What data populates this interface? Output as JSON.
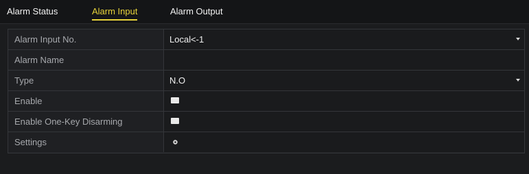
{
  "tabs": [
    {
      "label": "Alarm Status",
      "active": false
    },
    {
      "label": "Alarm Input",
      "active": true
    },
    {
      "label": "Alarm Output",
      "active": false
    }
  ],
  "form": {
    "alarm_input_no": {
      "label": "Alarm Input No.",
      "value": "Local<-1"
    },
    "alarm_name": {
      "label": "Alarm Name",
      "value": ""
    },
    "type": {
      "label": "Type",
      "value": "N.O"
    },
    "enable": {
      "label": "Enable",
      "checked": false
    },
    "one_key_disarming": {
      "label": "Enable One-Key Disarming",
      "checked": false
    },
    "settings": {
      "label": "Settings",
      "icon": "gear-icon"
    }
  },
  "colors": {
    "active_tab": "#e6d23a",
    "background": "#1b1c1e",
    "label_text": "#a6a8ac",
    "value_text": "#f0f0f0"
  }
}
